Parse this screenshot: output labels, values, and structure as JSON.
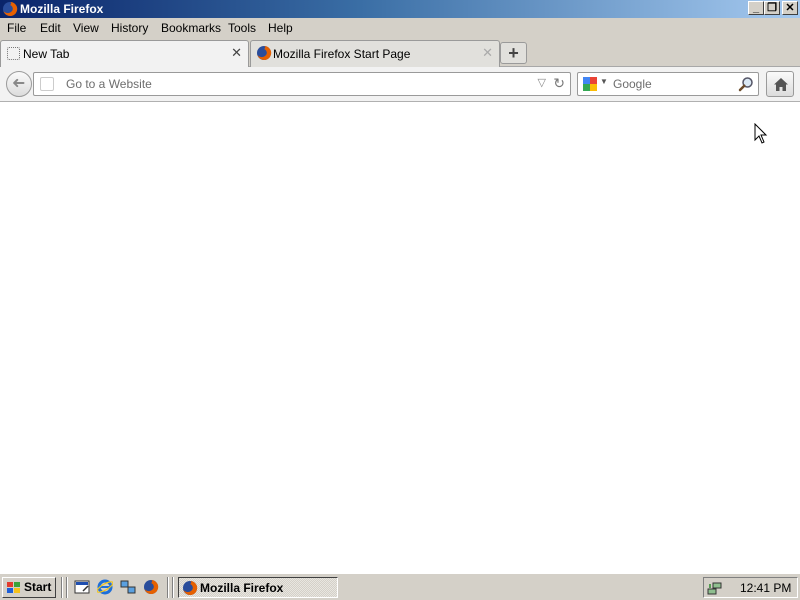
{
  "window": {
    "title": "Mozilla Firefox",
    "minimize": "_",
    "maximize": "❐",
    "close": "✕"
  },
  "menu": [
    "File",
    "Edit",
    "View",
    "History",
    "Bookmarks",
    "Tools",
    "Help"
  ],
  "tabs": [
    {
      "label": "New Tab",
      "active": true
    },
    {
      "label": "Mozilla Firefox Start Page",
      "active": false
    }
  ],
  "tab_close": "✕",
  "new_tab": "+",
  "navbar": {
    "back": "➜",
    "url_placeholder": "Go to a Website",
    "url_value": "",
    "dropmarker": "▽",
    "reload": "↻",
    "search_placeholder": "Google",
    "search_engine_drop": "▼"
  },
  "taskbar": {
    "start_label": "Start",
    "task_label": "Mozilla Firefox",
    "clock": "12:41 PM"
  },
  "icons": {
    "firefox": "firefox-icon",
    "home": "home-icon",
    "google": "google-icon",
    "magnifier": "search-icon"
  },
  "colors": {
    "titlebar_start": "#0a246a",
    "titlebar_end": "#a6caf0",
    "chrome": "#d4d0c8",
    "content": "#ffffff"
  }
}
